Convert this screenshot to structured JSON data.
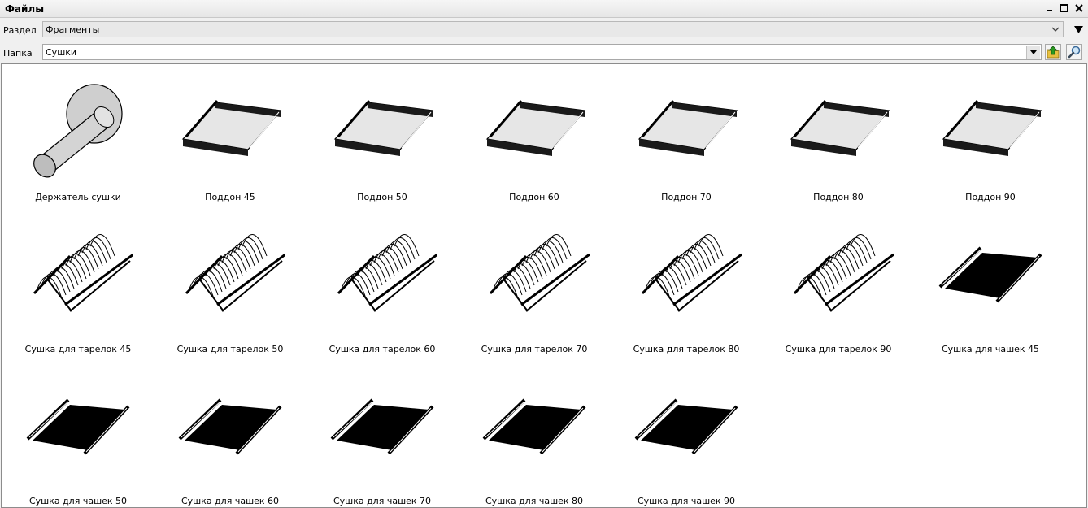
{
  "window": {
    "title": "Файлы"
  },
  "section": {
    "label": "Раздел",
    "value": "Фрагменты"
  },
  "folder": {
    "label": "Папка",
    "value": "Сушки"
  },
  "icons": {
    "minimize": "minimize-icon",
    "maximize": "maximize-icon",
    "close": "close-icon",
    "dropdown": "chevron-down-icon",
    "menu": "triangle-down-icon",
    "folder_up": "folder-up-icon",
    "search": "magnifier-icon"
  },
  "colors": {
    "folder_up_arrow": "#2a9a20",
    "folder_body": "#e8c040"
  },
  "files": [
    {
      "label": "Держатель сушки",
      "kind": "holder"
    },
    {
      "label": "Поддон 45",
      "kind": "tray"
    },
    {
      "label": "Поддон 50",
      "kind": "tray"
    },
    {
      "label": "Поддон 60",
      "kind": "tray"
    },
    {
      "label": "Поддон 70",
      "kind": "tray"
    },
    {
      "label": "Поддон 80",
      "kind": "tray"
    },
    {
      "label": "Поддон 90",
      "kind": "tray"
    },
    {
      "label": "Сушка для тарелок 45",
      "kind": "plates"
    },
    {
      "label": "Сушка для тарелок 50",
      "kind": "plates"
    },
    {
      "label": "Сушка для тарелок 60",
      "kind": "plates"
    },
    {
      "label": "Сушка для тарелок 70",
      "kind": "plates"
    },
    {
      "label": "Сушка для тарелок 80",
      "kind": "plates"
    },
    {
      "label": "Сушка для тарелок 90",
      "kind": "plates"
    },
    {
      "label": "Сушка для чашек 45",
      "kind": "cups"
    },
    {
      "label": "Сушка для чашек 50",
      "kind": "cups"
    },
    {
      "label": "Сушка для чашек 60",
      "kind": "cups"
    },
    {
      "label": "Сушка для чашек 70",
      "kind": "cups"
    },
    {
      "label": "Сушка для чашек 80",
      "kind": "cups"
    },
    {
      "label": "Сушка для чашек 90",
      "kind": "cups"
    }
  ]
}
